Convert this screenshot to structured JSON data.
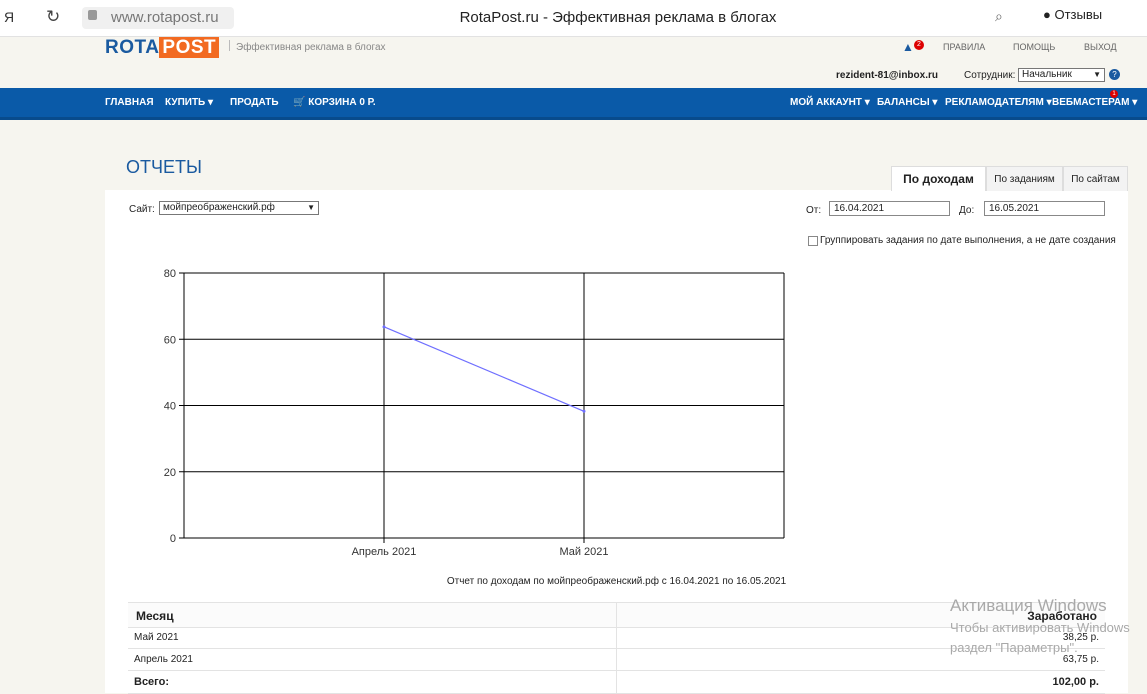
{
  "browser": {
    "url": "www.rotapost.ru",
    "tab_title": "RotaPost.ru - Эффективная реклама в блогах",
    "feedback_label": "Отзывы"
  },
  "site": {
    "logo_part1": "ROTA",
    "logo_part2": "POST",
    "tagline": "Эффективная реклама в блогах",
    "notification_count": "2",
    "top_links": [
      "ПРАВИЛА",
      "ПОМОЩЬ",
      "ВЫХОД"
    ],
    "user_email": "rezident-81@inbox.ru",
    "employee_label": "Сотрудник:",
    "employee_value": "Начальник"
  },
  "nav": {
    "left": [
      "ГЛАВНАЯ",
      "КУПИТЬ",
      "ПРОДАТЬ",
      "КОРЗИНА 0 Р."
    ],
    "right": [
      "МОЙ АККАУНТ",
      "БАЛАНСЫ",
      "РЕКЛАМОДАТЕЛЯМ",
      "ВЕБМАСТЕРАМ"
    ],
    "webmaster_badge": "1"
  },
  "page": {
    "title": "ОТЧЕТЫ",
    "tabs": [
      "По доходам",
      "По заданиям",
      "По сайтам"
    ],
    "active_tab": 0,
    "site_label": "Сайт:",
    "site_value": "мойпреображенский.рф",
    "from_label": "От:",
    "from_value": "16.04.2021",
    "to_label": "До:",
    "to_value": "16.05.2021",
    "group_checkbox_label": "Группировать задания по дате выполнения, а не дате создания",
    "caption": "Отчет по доходам по мойпреображенский.рф с 16.04.2021 по 16.05.2021"
  },
  "chart_data": {
    "type": "line",
    "x": [
      "Апрель 2021",
      "Май 2021"
    ],
    "series": [
      {
        "values": [
          63.75,
          38.25
        ],
        "color": "#6f6fff"
      }
    ],
    "y_ticks": [
      0,
      20,
      40,
      60,
      80
    ],
    "ylim": [
      0,
      80
    ],
    "grid": true
  },
  "table": {
    "headers": [
      "Месяц",
      "Заработано"
    ],
    "rows": [
      {
        "month": "Май 2021",
        "amount": "38,25 р."
      },
      {
        "month": "Апрель 2021",
        "amount": "63,75 р."
      }
    ],
    "total_label": "Всего:",
    "total_value": "102,00 р."
  },
  "watermark": {
    "line1": "Активация Windows",
    "line2": "Чтобы активировать Windows",
    "line3": "раздел \"Параметры\"."
  }
}
